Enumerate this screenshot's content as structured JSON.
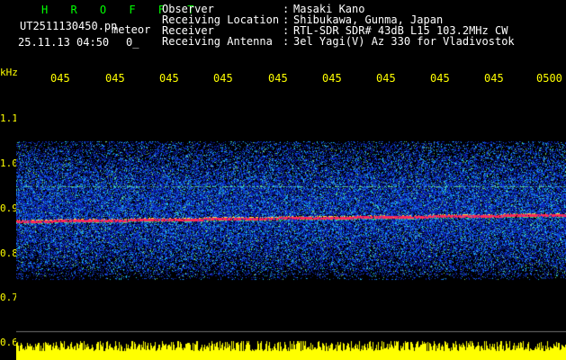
{
  "header": {
    "brand": "H R O F F T",
    "filename": "UT2511130450.pn",
    "tag": "meteor",
    "datetime": "25.11.13 04:50",
    "count": "0_",
    "fields": [
      {
        "label": "Observer",
        "value": "Masaki Kano"
      },
      {
        "label": "Receiving Location",
        "value": "Shibukawa, Gunma, Japan"
      },
      {
        "label": "Receiver",
        "value": "RTL-SDR SDR# 43dB L15 103.2MHz CW"
      },
      {
        "label": "Receiving Antenna",
        "value": "3el Yagi(V) Az 330 for Vladivostok"
      }
    ]
  },
  "time_ticks": [
    "045",
    "045",
    "045",
    "045",
    "045",
    "045",
    "045",
    "045",
    "045",
    "0500"
  ],
  "y_axis": {
    "unit": "kHz",
    "labels": [
      "1.1",
      "1.0",
      "0.9",
      "0.8",
      "0.7",
      "0.6"
    ]
  },
  "colors": {
    "label_yellow": "#ffff00",
    "brand_green": "#00ff00",
    "signal_red": "#ff2050",
    "noise_blue": "#1030d0"
  }
}
